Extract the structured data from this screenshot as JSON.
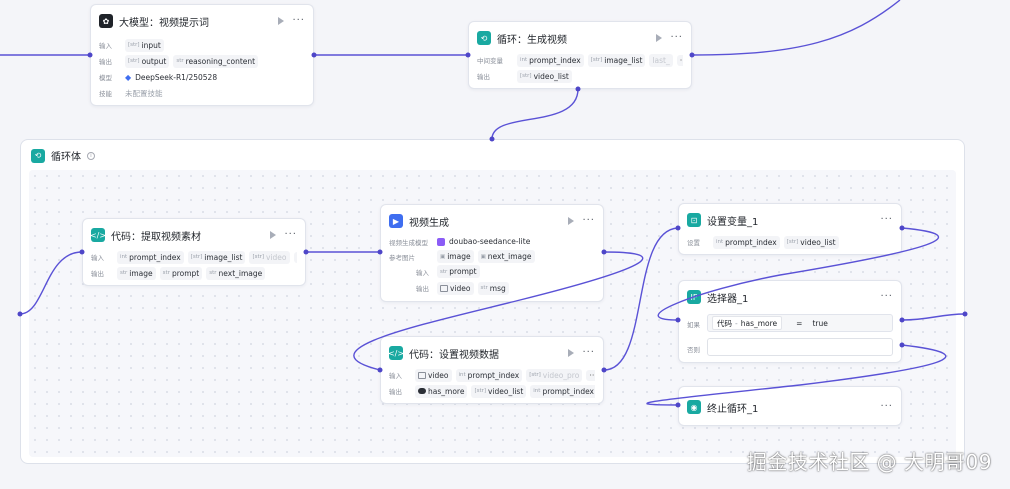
{
  "loop_body": {
    "title": "循环体"
  },
  "nodes": {
    "llm": {
      "title": "大模型：视频提示词",
      "rows": {
        "input_label": "输入",
        "output_label": "输出",
        "model_label": "模型",
        "skill_label": "技能"
      },
      "inputs": [
        {
          "type": "[str]",
          "name": "input"
        }
      ],
      "outputs": [
        {
          "type": "[str]",
          "name": "output"
        },
        {
          "type": "str",
          "name": "reasoning_content"
        }
      ],
      "model": "DeepSeek-R1/250528",
      "skill": "未配置技能"
    },
    "loop": {
      "title": "循环：生成视频",
      "rows": {
        "mid_label": "中间变量",
        "output_label": "输出"
      },
      "mid_vars": [
        {
          "type": "int",
          "name": "prompt_index"
        },
        {
          "type": "[str]",
          "name": "image_list"
        },
        {
          "type": "",
          "name": "last_"
        }
      ],
      "outputs": [
        {
          "type": "[str]",
          "name": "video_list"
        }
      ]
    },
    "code_extract": {
      "title": "代码：提取视频素材",
      "rows": {
        "input_label": "输入",
        "output_label": "输出"
      },
      "inputs": [
        {
          "type": "int",
          "name": "prompt_index"
        },
        {
          "type": "[str]",
          "name": "image_list"
        },
        {
          "type": "[str]",
          "name": "video"
        }
      ],
      "outputs": [
        {
          "type": "str",
          "name": "image"
        },
        {
          "type": "str",
          "name": "prompt"
        },
        {
          "type": "str",
          "name": "next_image"
        }
      ]
    },
    "video_gen": {
      "title": "视频生成",
      "rows": {
        "model_label": "视频生成模型",
        "ref_label": "参考图片",
        "input_label": "输入",
        "output_label": "输出"
      },
      "model": "doubao-seedance-lite",
      "ref_images": [
        "image",
        "next_image"
      ],
      "inputs": [
        {
          "type": "str",
          "name": "prompt"
        }
      ],
      "outputs": [
        {
          "type": "",
          "name": "video"
        },
        {
          "type": "str",
          "name": "msg"
        }
      ]
    },
    "code_set": {
      "title": "代码：设置视频数据",
      "rows": {
        "input_label": "输入",
        "output_label": "输出"
      },
      "inputs": [
        {
          "type": "",
          "name": "video"
        },
        {
          "type": "int",
          "name": "prompt_index"
        },
        {
          "type": "[str]",
          "name": "video_pro"
        }
      ],
      "outputs": [
        {
          "type": "",
          "name": "has_more"
        },
        {
          "type": "[str]",
          "name": "video_list"
        },
        {
          "type": "int",
          "name": "prompt_index"
        }
      ]
    },
    "set_var": {
      "title": "设置变量_1",
      "rows": {
        "set_label": "设置"
      },
      "vars": [
        {
          "type": "int",
          "name": "prompt_index"
        },
        {
          "type": "[str]",
          "name": "video_list"
        }
      ]
    },
    "selector": {
      "title": "选择器_1",
      "rows": {
        "if_label": "如果",
        "else_label": "否则"
      },
      "condition": {
        "source": "代码",
        "field": "has_more",
        "op": "=",
        "value": "true"
      }
    },
    "stop": {
      "title": "终止循环_1"
    }
  },
  "watermark": "掘金技术社区 @ 大明哥09"
}
